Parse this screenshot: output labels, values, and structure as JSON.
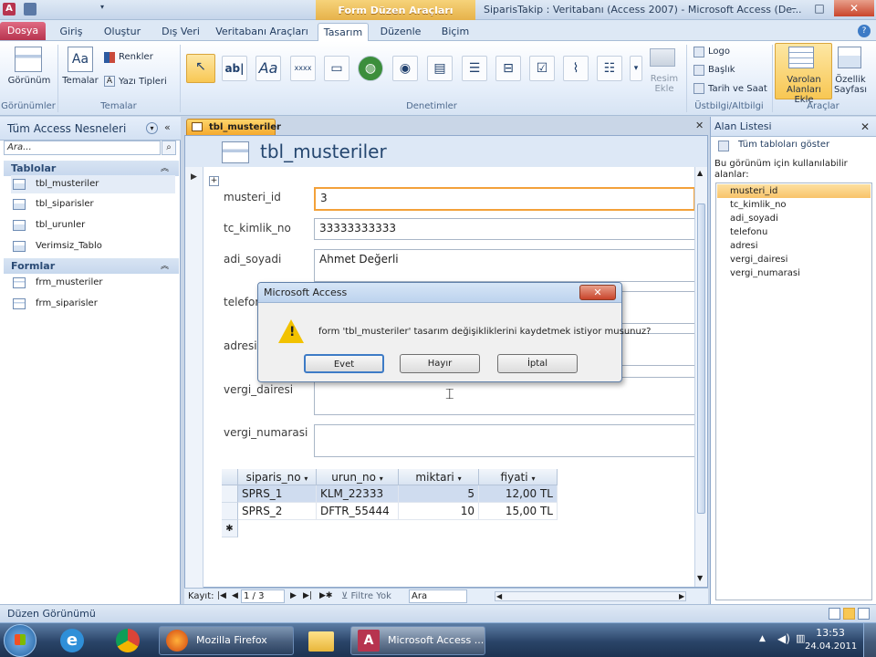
{
  "window": {
    "context_tab": "Form Düzen Araçları",
    "title": "SiparisTakip : Veritabanı (Access 2007) - Microsoft Access (De...",
    "min": "–",
    "max": "□",
    "close": "✕"
  },
  "tabs": [
    "Dosya",
    "Giriş",
    "Oluştur",
    "Dış Veri",
    "Veritabanı Araçları",
    "Tasarım",
    "Düzenle",
    "Biçim"
  ],
  "ribbon": {
    "gorunum": "Görünüm",
    "temalar": "Temalar",
    "renkler": "Renkler",
    "yazi_tipleri": "Yazı Tipleri",
    "resim_ekle": "Resim Ekle",
    "logo": "Logo",
    "baslik": "Başlık",
    "tarih_saat": "Tarih ve Saat",
    "varolan_alanlari_ekle": "Varolan Alanları Ekle",
    "ozellik_sayfasi": "Özellik Sayfası",
    "groups": {
      "gorunumler": "Görünümler",
      "temalar": "Temalar",
      "denetimler": "Denetimler",
      "ustbilgi": "Üstbilgi/Altbilgi",
      "araclar": "Araçlar"
    }
  },
  "nav": {
    "header": "Tüm Access Nesneleri",
    "search_placeholder": "Ara...",
    "group_tables": "Tablolar",
    "tables": [
      "tbl_musteriler",
      "tbl_siparisler",
      "tbl_urunler",
      "Verimsiz_Tablo"
    ],
    "group_forms": "Formlar",
    "forms": [
      "frm_musteriler",
      "frm_siparisler"
    ]
  },
  "document": {
    "tab": "tbl_musteriler",
    "form_title": "tbl_musteriler",
    "fields": [
      {
        "label": "musteri_id",
        "value": "3"
      },
      {
        "label": "tc_kimlik_no",
        "value": "33333333333"
      },
      {
        "label": "adi_soyadi",
        "value": "Ahmet Değerli"
      },
      {
        "label": "telefonu",
        "value": ""
      },
      {
        "label": "adresi",
        "value": ""
      },
      {
        "label": "vergi_dairesi",
        "value": ""
      },
      {
        "label": "vergi_numarasi",
        "value": ""
      }
    ]
  },
  "subform": {
    "columns": [
      "siparis_no",
      "urun_no",
      "miktari",
      "fiyati"
    ],
    "rows": [
      [
        "SPRS_1",
        "KLM_22333",
        "5",
        "12,00 TL"
      ],
      [
        "SPRS_2",
        "DFTR_55444",
        "10",
        "15,00 TL"
      ]
    ],
    "new_row_marker": "✱"
  },
  "recnav": {
    "label": "Kayıt:",
    "position": "1 / 3",
    "filter": "Filtre Yok",
    "search": "Ara"
  },
  "field_list": {
    "header": "Alan Listesi",
    "show_all": "Tüm tabloları göster",
    "description": "Bu görünüm için kullanılabilir alanlar:",
    "items": [
      "musteri_id",
      "tc_kimlik_no",
      "adi_soyadi",
      "telefonu",
      "adresi",
      "vergi_dairesi",
      "vergi_numarasi"
    ]
  },
  "status": {
    "text": "Düzen Görünümü"
  },
  "taskbar": {
    "firefox": "Mozilla Firefox",
    "access": "Microsoft Access ...",
    "time": "13:53",
    "date": "24.04.2011"
  },
  "dialog": {
    "title": "Microsoft Access",
    "message": "form 'tbl_musteriler' tasarım değişikliklerini kaydetmek istiyor musunuz?",
    "yes": "Evet",
    "no": "Hayır",
    "cancel": "İptal"
  },
  "colors": {
    "accent": "#f3a13a",
    "file_tab": "#b7344f",
    "selection": "#f8c753"
  }
}
